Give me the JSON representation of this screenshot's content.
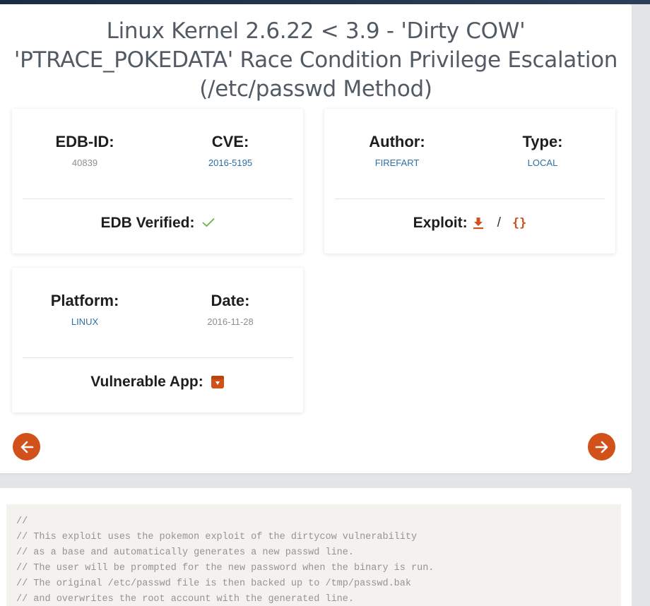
{
  "title_lines": [
    "Linux Kernel 2.6.22 < 3.9 - 'Dirty COW'",
    "'PTRACE_POKEDATA' Race Condition Privilege Escalation",
    "(/etc/passwd Method)"
  ],
  "card1": {
    "edb_id_label": "EDB-ID:",
    "edb_id_value": "40839",
    "cve_label": "CVE:",
    "cve_value": "2016-5195",
    "verified_label": "EDB Verified:",
    "verified_icon": "check-icon"
  },
  "card2": {
    "author_label": "Author:",
    "author_value": "FIREFART",
    "type_label": "Type:",
    "type_value": "LOCAL",
    "exploit_label": "Exploit:",
    "exploit_separator": "/",
    "raw_icon_text": "{}"
  },
  "card3": {
    "platform_label": "Platform:",
    "platform_value": "LINUX",
    "date_label": "Date:",
    "date_value": "2016-11-28",
    "vuln_app_label": "Vulnerable App:"
  },
  "colors": {
    "accent": "#d2501a",
    "link": "#2d6fa3",
    "check": "#6ab04c"
  },
  "code_lines": [
    "//",
    "// This exploit uses the pokemon exploit of the dirtycow vulnerability",
    "// as a base and automatically generates a new passwd line.",
    "// The user will be prompted for the new password when the binary is run.",
    "// The original /etc/passwd file is then backed up to /tmp/passwd.bak",
    "// and overwrites the root account with the generated line."
  ]
}
